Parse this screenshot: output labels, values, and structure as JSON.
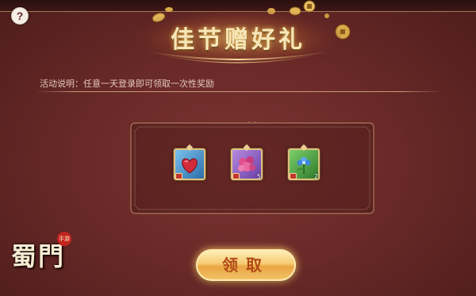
{
  "header": {
    "title": "佳节赠好礼",
    "help_icon": "question-mark-icon",
    "help_glyph": "?"
  },
  "activity": {
    "description": "活动说明：任意一天登录即可领取一次性奖励"
  },
  "rewards": [
    {
      "icon": "heart-icon",
      "frame_color": "#4d9ad6",
      "count": ""
    },
    {
      "icon": "flower-bouquet-icon",
      "frame_color": "#8e5fc4",
      "count": "5"
    },
    {
      "icon": "blue-flower-icon",
      "frame_color": "#4c9a3c",
      "count": "2"
    }
  ],
  "claim_button": {
    "label": "领取"
  },
  "logo": {
    "text": "蜀門",
    "badge": "手游"
  },
  "colors": {
    "panel": "#6a2a28",
    "accent_gold": "#f6e6b8",
    "button_text": "#b04a17"
  }
}
